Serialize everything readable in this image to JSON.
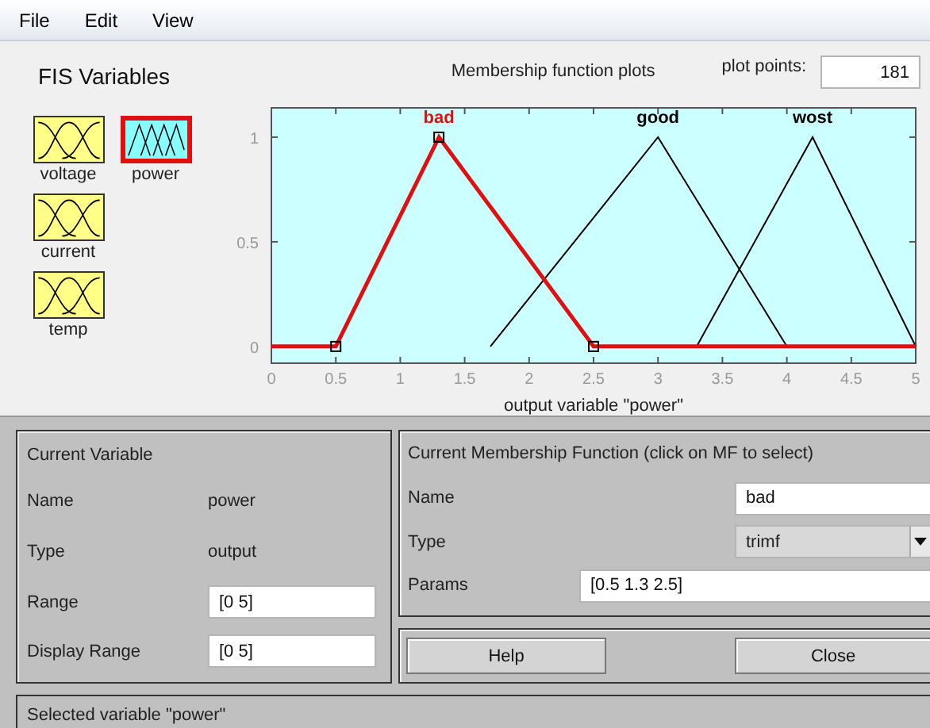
{
  "menu": [
    "File",
    "Edit",
    "View"
  ],
  "fis_variables": {
    "title": "FIS Variables",
    "variables": [
      {
        "name": "voltage",
        "kind": "input",
        "selected": false
      },
      {
        "name": "power",
        "kind": "output",
        "selected": true
      },
      {
        "name": "current",
        "kind": "input",
        "selected": false
      },
      {
        "name": "temp",
        "kind": "input",
        "selected": false
      }
    ]
  },
  "plot": {
    "title": "Membership function plots",
    "plot_points_label": "plot points:",
    "plot_points": "181",
    "chart_data": {
      "type": "line",
      "xlabel": "output variable \"power\"",
      "x": [
        0,
        0.5,
        1.3,
        1.7,
        2.5,
        3,
        3.3,
        4,
        4.2,
        5
      ],
      "xlim": [
        0,
        5
      ],
      "ylim": [
        -0.08,
        1.14
      ],
      "xticks": [
        0,
        0.5,
        1,
        1.5,
        2,
        2.5,
        3,
        3.5,
        4,
        4.5,
        5
      ],
      "yticks": [
        0,
        0.5,
        1
      ],
      "series": [
        {
          "name": "bad",
          "color": "#e01010",
          "values": [
            0,
            0,
            1,
            0.667,
            0,
            0,
            0,
            0,
            0,
            0
          ]
        },
        {
          "name": "good",
          "color": "#000000",
          "values": [
            null,
            null,
            null,
            0,
            0.615,
            1,
            0.7,
            0,
            null,
            null
          ]
        },
        {
          "name": "wost",
          "color": "#000000",
          "values": [
            null,
            null,
            null,
            null,
            null,
            null,
            0,
            0.778,
            1,
            0
          ]
        }
      ]
    },
    "curves": [
      {
        "selected": true
      },
      {
        "selected": false
      },
      {
        "selected": false
      }
    ]
  },
  "current_variable": {
    "title": "Current Variable",
    "name_label": "Name",
    "name": "power",
    "type_label": "Type",
    "type": "output",
    "range_label": "Range",
    "range": "[0 5]",
    "display_range_label": "Display Range",
    "display_range": "[0 5]"
  },
  "current_mf": {
    "title": "Current Membership Function (click on MF to select)",
    "name_label": "Name",
    "name": "bad",
    "type_label": "Type",
    "type": "trimf",
    "params_label": "Params",
    "params": "[0.5 1.3 2.5]"
  },
  "buttons": [
    "Help",
    "Close"
  ],
  "status_bar": "Selected variable \"power\""
}
